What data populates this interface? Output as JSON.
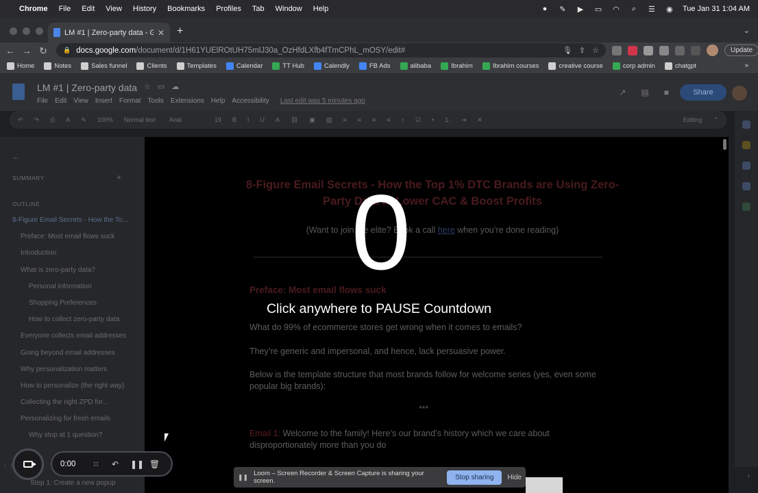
{
  "macbar": {
    "app": "Chrome",
    "menus": [
      "File",
      "Edit",
      "View",
      "History",
      "Bookmarks",
      "Profiles",
      "Tab",
      "Window",
      "Help"
    ],
    "datetime": "Tue Jan 31  1:04 AM"
  },
  "browser": {
    "tab_title": "LM #1 | Zero-party data - Goo",
    "url_domain": "docs.google.com",
    "url_path": "/document/d/1H61YUElROtUH75mlJ30a_OzHfdLXfb4fTmCPhL_mOSY/edit#",
    "update_label": "Update",
    "bookmarks": [
      {
        "label": "Home",
        "icon": "bookmark-icon"
      },
      {
        "label": "Notes",
        "icon": "bookmark-icon"
      },
      {
        "label": "Sales funnel",
        "icon": "bookmark-icon"
      },
      {
        "label": "Clients",
        "icon": "bookmark-icon"
      },
      {
        "label": "Templates",
        "icon": "bookmark-icon"
      },
      {
        "label": "Calendar",
        "icon": "bookmark-icon"
      },
      {
        "label": "TT Hub",
        "icon": "drive-icon"
      },
      {
        "label": "Calendly",
        "icon": "calendly-icon"
      },
      {
        "label": "FB Ads",
        "icon": "meta-icon"
      },
      {
        "label": "alibaba",
        "icon": "sheets-icon"
      },
      {
        "label": "Ibrahim",
        "icon": "sheets-icon"
      },
      {
        "label": "Ibrahim courses",
        "icon": "sheets-icon"
      },
      {
        "label": "creative course",
        "icon": "bookmark-icon"
      },
      {
        "label": "corp admin",
        "icon": "sheets-icon"
      },
      {
        "label": "chatgpt",
        "icon": "bookmark-icon"
      }
    ],
    "bookmarks_more": "»"
  },
  "docs": {
    "title": "LM #1 | Zero-party data",
    "menu": [
      "File",
      "Edit",
      "View",
      "Insert",
      "Format",
      "Tools",
      "Extensions",
      "Help",
      "Accessibility"
    ],
    "last_edit": "Last edit was 5 minutes ago",
    "share_label": "Share",
    "toolbar": {
      "zoom": "100%",
      "style": "Normal text",
      "font": "Arial",
      "size": "19",
      "mode": "Editing"
    },
    "summary_label": "SUMMARY",
    "outline_label": "OUTLINE",
    "outline": [
      {
        "text": "8-Figure Email Secrets - How the Top 1% DTC Brands are...",
        "level": 1
      },
      {
        "text": "Preface: Most email flows suck",
        "level": 2
      },
      {
        "text": "Introduction",
        "level": 2
      },
      {
        "text": "What is zero-party data?",
        "level": 2
      },
      {
        "text": "Personal information",
        "level": 3
      },
      {
        "text": "Shopping Preferences",
        "level": 3
      },
      {
        "text": "How to collect zero-party data",
        "level": 3
      },
      {
        "text": "Everyone collects email addresses",
        "level": 2
      },
      {
        "text": "Going beyond email addresses",
        "level": 2
      },
      {
        "text": "Why personalization matters",
        "level": 2
      },
      {
        "text": "How to personalize (the right way)",
        "level": 2
      },
      {
        "text": "Collecting the right ZPD for...",
        "level": 2
      },
      {
        "text": "Personalizing for fresh emails",
        "level": 2
      },
      {
        "text": "Why stop at 1 question?",
        "level": 3
      }
    ],
    "outline_bottom": "Step 1: Create a new popup",
    "content": {
      "h1": "8-Figure Email Secrets - How the Top 1% DTC Brands are Using Zero-Party Data to Lower CAC & Boost Profits",
      "sub_pre": "(Want to join the elite? Book a call ",
      "sub_link": "here",
      "sub_post": " when you’re done reading)",
      "h2": "Preface: Most email flows suck",
      "p1": "What do 99% of ecommerce stores get wrong when it comes to emails?",
      "p2": "They’re generic and impersonal, and hence, lack persuasive power.",
      "p3": "Below is the template structure that most brands follow for welcome series (yes, even some popular big brands):",
      "stars": "***",
      "email_label": "Email 1:",
      "email_text": " Welcome to the family! Here’s our brand’s history which we care about disproportionately more than you do"
    }
  },
  "overlay": {
    "countdown": "0",
    "instruction": "Click anywhere to PAUSE Countdown"
  },
  "loom": {
    "timer": "0:00",
    "share_message": "Loom – Screen Recorder & Screen Capture is sharing your screen.",
    "stop_label": "Stop sharing",
    "hide_label": "Hide"
  }
}
